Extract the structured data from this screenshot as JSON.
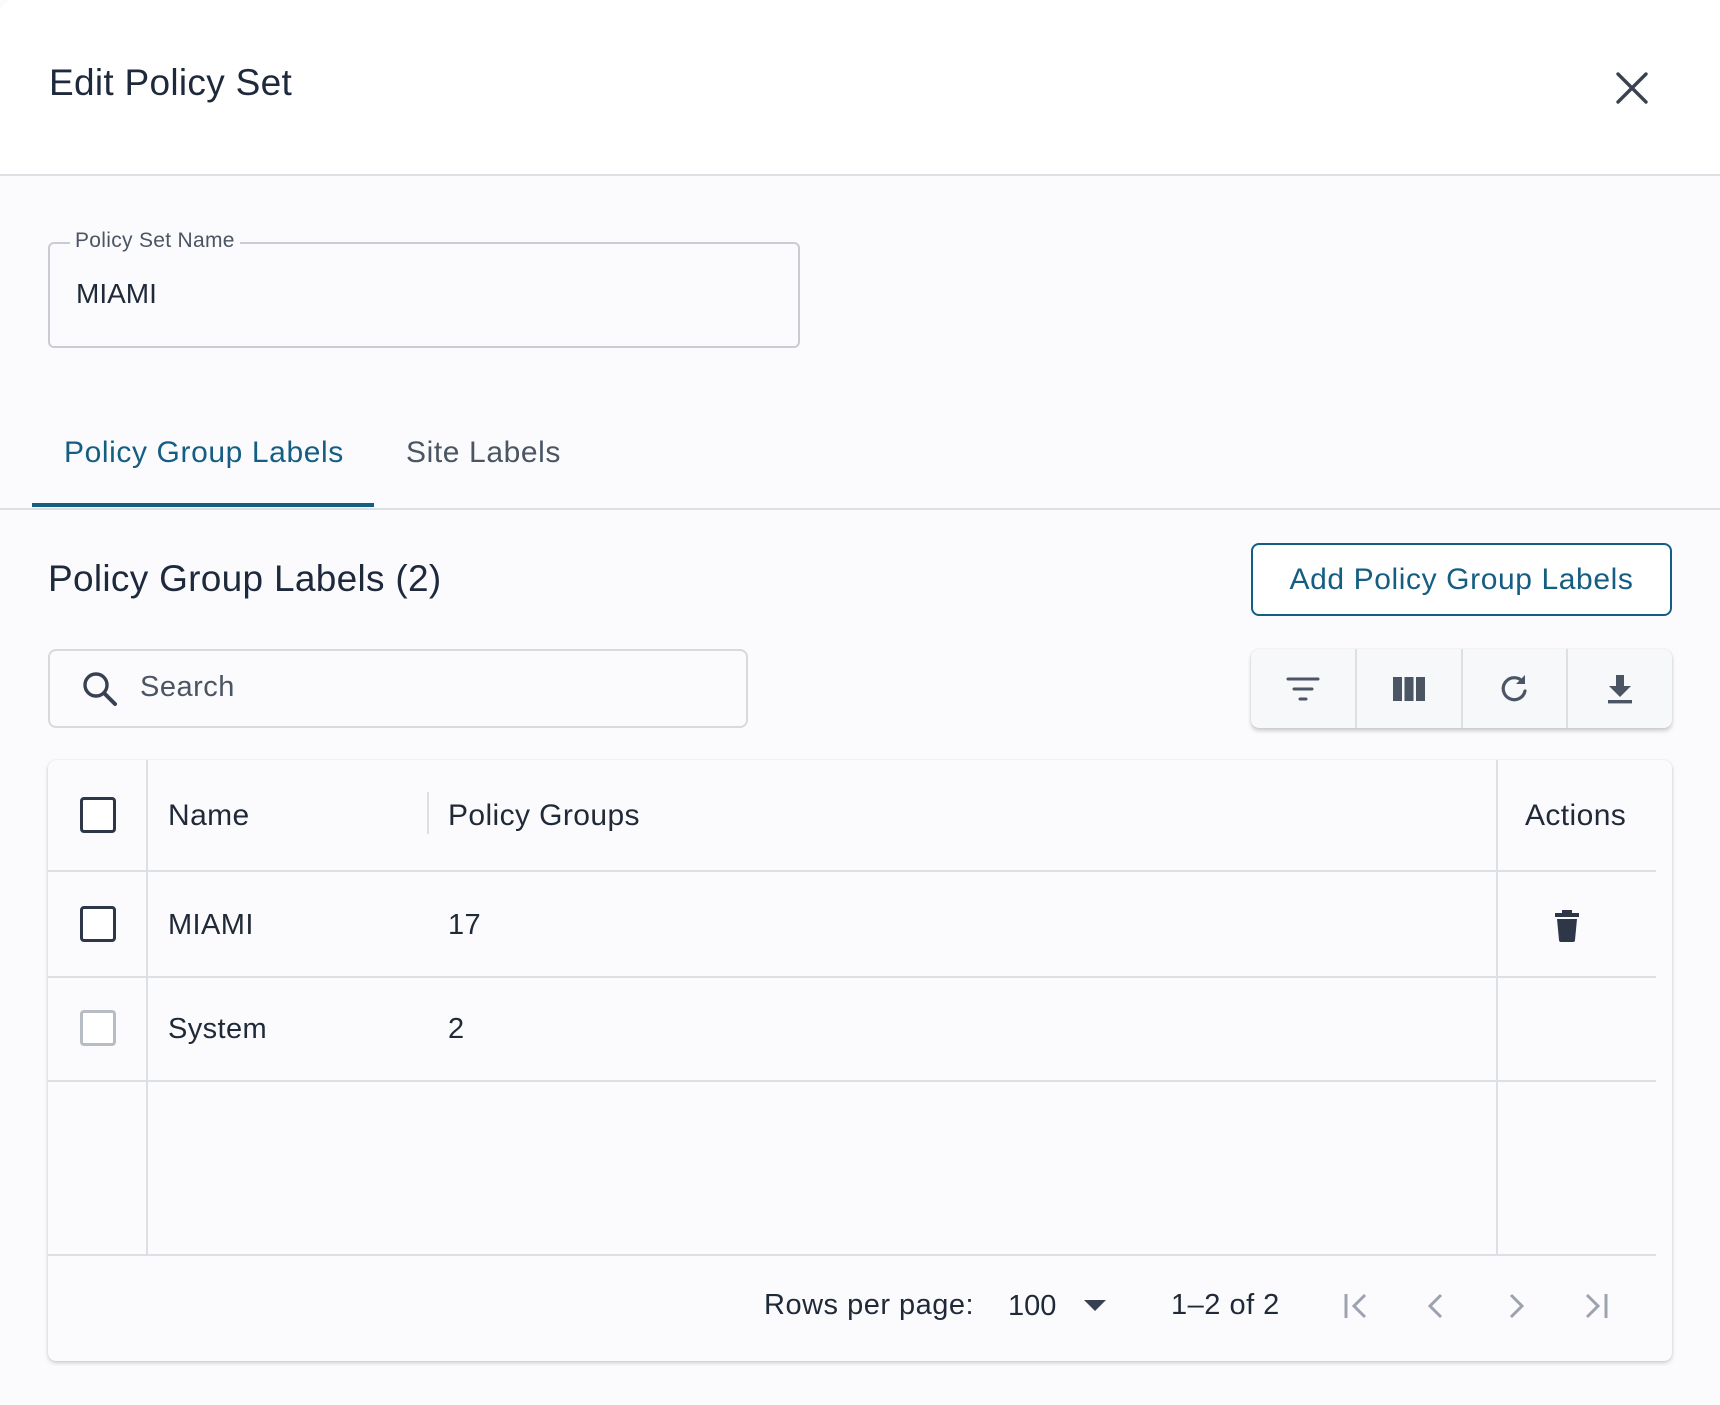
{
  "dialog": {
    "title": "Edit Policy Set"
  },
  "form": {
    "policy_set_name_label": "Policy Set Name",
    "policy_set_name_value": "MIAMI"
  },
  "tabs": [
    {
      "label": "Policy Group Labels",
      "active": true
    },
    {
      "label": "Site Labels",
      "active": false
    }
  ],
  "section": {
    "title": "Policy Group Labels (2)",
    "add_button_label": "Add Policy Group Labels"
  },
  "search": {
    "placeholder": "Search"
  },
  "toolbar": {
    "icons": [
      "filter-icon",
      "columns-icon",
      "refresh-icon",
      "download-icon"
    ]
  },
  "table": {
    "columns": [
      "Name",
      "Policy Groups",
      "Actions"
    ],
    "rows": [
      {
        "name": "MIAMI",
        "policy_groups": "17",
        "deletable": true,
        "selectable": true
      },
      {
        "name": "System",
        "policy_groups": "2",
        "deletable": false,
        "selectable": false
      }
    ]
  },
  "pagination": {
    "rows_per_page_label": "Rows per page:",
    "rows_per_page_value": "100",
    "range_label": "1–2 of 2"
  },
  "colors": {
    "accent": "#155e83",
    "text": "#1f2937",
    "border": "#dcdfe4"
  }
}
